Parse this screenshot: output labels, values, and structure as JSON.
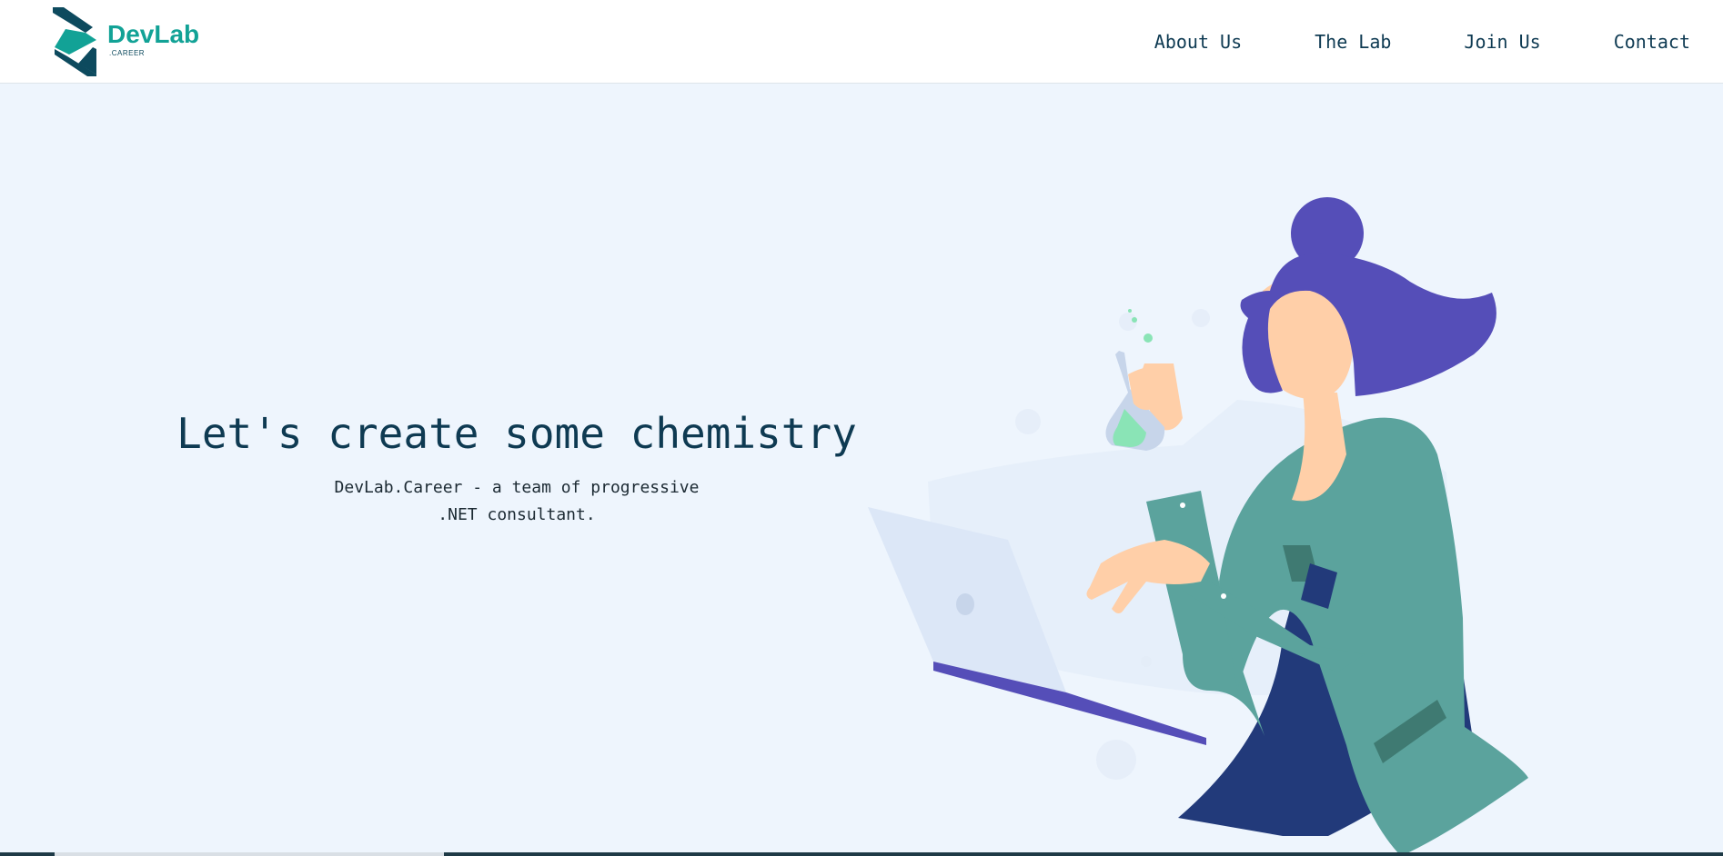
{
  "brand": {
    "name": "DevLab",
    "sub": ".CAREER",
    "colors": {
      "teal": "#12a296",
      "navy": "#0d4a5e"
    }
  },
  "nav": {
    "items": [
      {
        "label": "About Us"
      },
      {
        "label": "The Lab"
      },
      {
        "label": "Join Us"
      },
      {
        "label": "Contact"
      }
    ]
  },
  "hero": {
    "title": "Let's create some chemistry",
    "subtitle_line1": "DevLab.Career - a team of progressive",
    "subtitle_line2": ".NET consultant.",
    "illustration": "scientist-with-flask-and-laptop"
  },
  "colors": {
    "background": "#eef5fd",
    "text": "#0e3a52",
    "hair": "#554eb8",
    "coat": "#5ba39d",
    "skin": "#ffcfa8",
    "laptop": "#dce7f7"
  }
}
